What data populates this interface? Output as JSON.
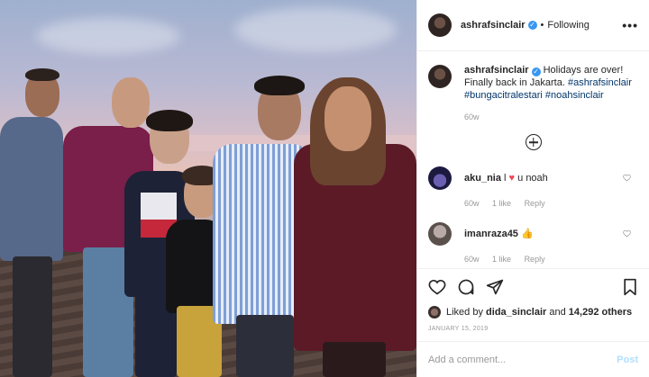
{
  "header": {
    "username": "ashrafsinclair",
    "separator": "•",
    "follow_status": "Following",
    "more_glyph": "•••"
  },
  "caption": {
    "username": "ashrafsinclair",
    "text": "Holidays are over! Finally back in Jakarta.",
    "tags": [
      "#ashrafsinclair",
      "#bungacitralestari",
      "#noahsinclair"
    ],
    "time": "60w"
  },
  "comments": [
    {
      "username": "aku_nia",
      "text_before": "l",
      "emoji": "heart",
      "text_after": "u noah",
      "time": "60w",
      "likes": "1 like",
      "reply": "Reply"
    },
    {
      "username": "imanraza45",
      "text_before": "",
      "emoji": "thumbs-up",
      "text_after": "",
      "time": "60w",
      "likes": "1 like",
      "reply": "Reply"
    }
  ],
  "likes": {
    "prefix": "Liked by",
    "user": "dida_sinclair",
    "joiner": "and",
    "count": "14,292 others"
  },
  "date": "JANUARY 15, 2019",
  "add_comment": {
    "placeholder": "Add a comment...",
    "post_label": "Post"
  },
  "colors": {
    "verified": "#3897f0",
    "tag": "#003569",
    "muted": "#999999",
    "post_disabled": "#b2dffc",
    "heart": "#ed4956"
  }
}
